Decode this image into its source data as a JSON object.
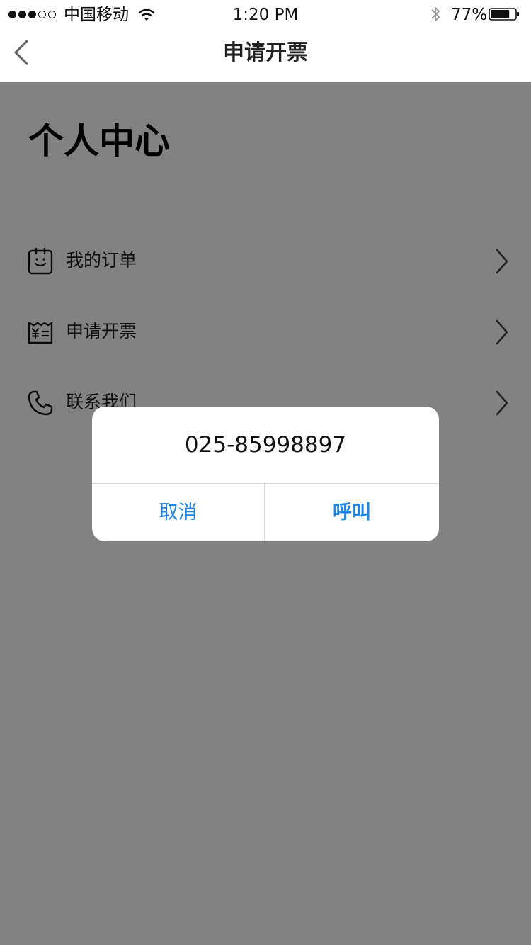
{
  "status_bar": {
    "carrier": "中国移动",
    "time": "1:20 PM",
    "battery": "77%",
    "battery_level": 0.77,
    "signal_bars_filled": 3,
    "signal_bars_total": 5,
    "icons": [
      "signal-dots-icon",
      "wifi-icon",
      "bluetooth-icon",
      "battery-icon"
    ]
  },
  "nav": {
    "title": "申请开票",
    "back_icon": "chevron-left-icon"
  },
  "page": {
    "heading": "个人中心",
    "menu": [
      {
        "label": "我的订单",
        "icon": "order-icon"
      },
      {
        "label": "申请开票",
        "icon": "invoice-icon"
      },
      {
        "label": "联系我们",
        "icon": "phone-icon"
      }
    ]
  },
  "dialog": {
    "message": "025-85998897",
    "cancel_label": "取消",
    "confirm_label": "呼叫"
  },
  "colors": {
    "accent": "#1a85e6",
    "overlay": "rgba(0,0,0,0.49)"
  }
}
